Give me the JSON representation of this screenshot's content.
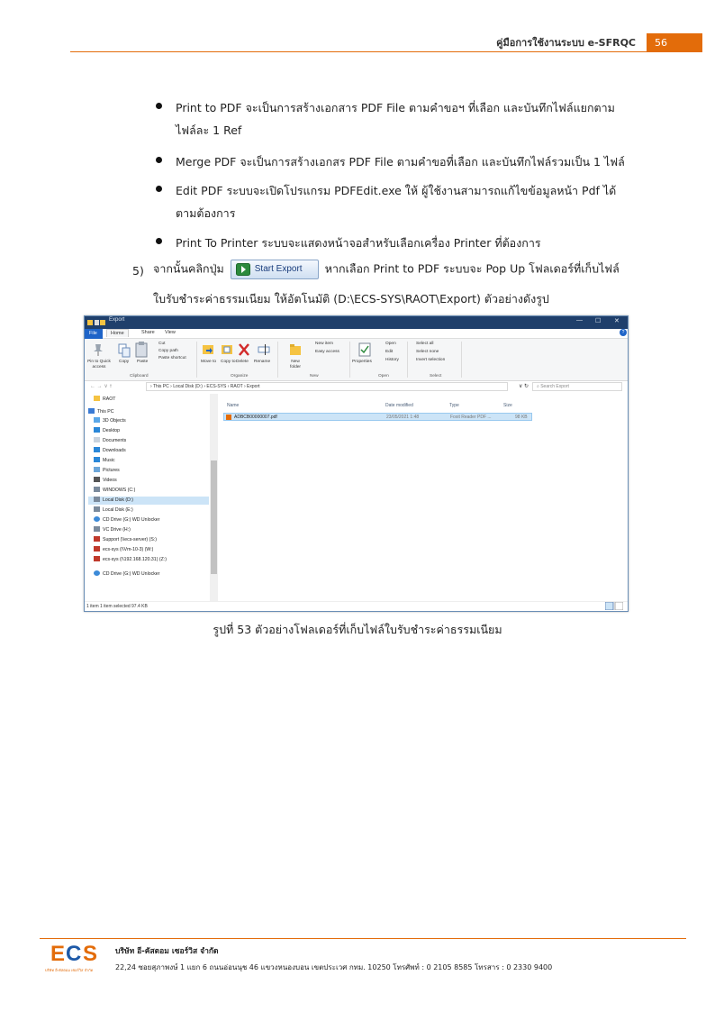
{
  "header": {
    "title": "คู่มือการใช้งานระบบ e-SFRQC",
    "page_number": "56"
  },
  "bullets": [
    {
      "line1": "Print to PDF จะเป็นการสร้างเอกสาร PDF File ตามคำขอฯ ที่เลือก และบันทึกไฟล์แยกตาม",
      "line2": "ไฟล์ละ 1 Ref"
    },
    {
      "line1": "Merge PDF จะเป็นการสร้างเอกสร PDF File ตามคำขอที่เลือก และบันทึกไฟล์รวมเป็น 1 ไฟล์",
      "line2": ""
    },
    {
      "line1": "Edit PDF ระบบจะเปิดโปรแกรม PDFEdit.exe ให้ ผู้ใช้งานสามารถแก้ไขข้อมูลหน้า Pdf ได้",
      "line2": "ตามต้องการ"
    },
    {
      "line1": "Print To Printer ระบบจะแสดงหน้าจอสำหรับเลือกเครื่อง Printer ที่ต้องการ",
      "line2": ""
    }
  ],
  "step5": {
    "number": "5)",
    "before": "จากนั้นคลิกปุ่ม",
    "button_label": "Start Export",
    "after": "หากเลือก Print to PDF ระบบจะ Pop Up โฟลเดอร์ที่เก็บไฟล์",
    "line2": "ใบรับชำระค่าธรรมเนียม ให้อัตโนมัติ (D:\\ECS-SYS\\RAOT\\Export) ตัวอย่างดังรูป"
  },
  "explorer": {
    "title": "Export",
    "tabs": [
      "File",
      "Home",
      "Share",
      "View"
    ],
    "ribbon": {
      "pin": "Pin to Quick access",
      "copy": "Copy",
      "paste": "Paste",
      "cut": "Cut",
      "copy_path": "Copy path",
      "paste_shortcut": "Paste shortcut",
      "move_to": "Move to",
      "copy_to": "Copy to",
      "delete": "Delete",
      "rename": "Rename",
      "new_folder": "New folder",
      "new_item": "New item",
      "easy_access": "Easy access",
      "properties": "Properties",
      "open": "Open",
      "edit": "Edit",
      "history": "History",
      "select_all": "Select all",
      "select_none": "Select none",
      "invert_selection": "Invert selection",
      "groups": [
        "Clipboard",
        "Organize",
        "New",
        "Open",
        "Select"
      ]
    },
    "address": "›  This PC  ›  Local Disk (D:)  ›  ECS-SYS  ›  RAOT  ›  Export",
    "search_placeholder": "Search Export",
    "nav_items": [
      "RAOT",
      "This PC",
      "3D Objects",
      "Desktop",
      "Documents",
      "Downloads",
      "Music",
      "Pictures",
      "Videos",
      "WINDOWS (C:)",
      "Local Disk (D:)",
      "Local Disk (E:)",
      "CD Drive (G:) WD Unlocker",
      "VC Drive (H:)",
      "Support (\\\\ecs-server) (S:)",
      "ecs-sys (\\\\Vm-10-3) (W:)",
      "ecs-sys (\\\\192.168.120.31) (Z:)",
      "CD Drive (G:) WD Unlocker"
    ],
    "columns": [
      "Name",
      "Date modified",
      "Type",
      "Size"
    ],
    "file": {
      "name": "ADBCB00000007.pdf",
      "date": "23/05/2021 1:48",
      "type": "Foxit Reader PDF ...",
      "size": "98 KB"
    },
    "status": "1 item    1 item selected  97.4 KB"
  },
  "caption": "รูปที่ 53 ตัวอย่างโฟลเดอร์ที่เก็บไฟล์ใบรับชำระค่าธรรมเนียม",
  "footer": {
    "logo_text": "ECS",
    "logo_sub": "บริษัท อี-คัสตอม เซอร์วิส จำกัด",
    "company": "บริษัท อี-คัสตอม เซอร์วิส จำกัด",
    "address": "22,24 ซอยสุภาพงษ์ 1 แยก 6 ถนนอ่อนนุช 46 แขวงหนองบอน เขตประเวศ กทม. 10250 โทรศัพท์ : 0 2105 8585  โทรสาร : 0 2330 9400"
  },
  "colors": {
    "accent": "#e36c0a",
    "selection": "#cce4f7",
    "titlebar": "#1f3f6b"
  }
}
